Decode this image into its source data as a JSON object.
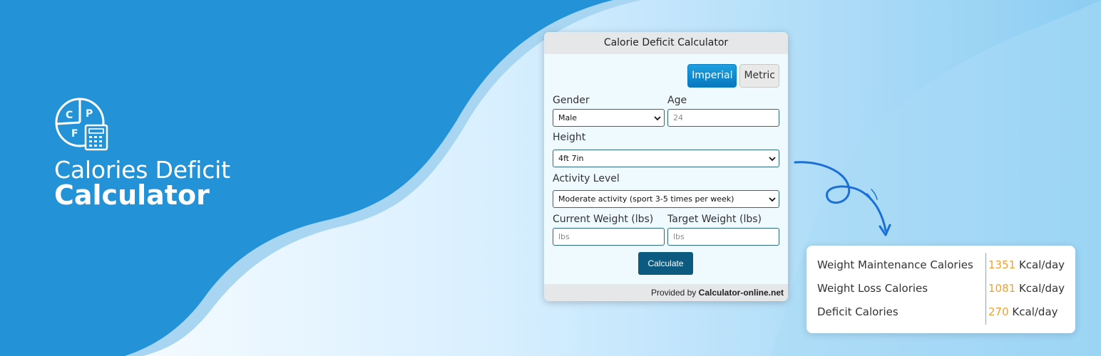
{
  "brand": {
    "logo_letters": [
      "C",
      "P",
      "F"
    ],
    "logo_icon": "calculator-pie-logo-icon",
    "title_line1": "Calories Deficit",
    "title_line2": "Calculator"
  },
  "colors": {
    "brand_blue": "#2492d6",
    "accent_orange": "#f0a12a",
    "button_dark": "#0d5a80"
  },
  "calculator": {
    "title": "Calorie Deficit Calculator",
    "units": [
      {
        "label": "Imperial",
        "active": true
      },
      {
        "label": "Metric",
        "active": false
      }
    ],
    "gender": {
      "label": "Gender",
      "value": "Male"
    },
    "age": {
      "label": "Age",
      "placeholder": "24"
    },
    "height": {
      "label": "Height",
      "value": "4ft 7in"
    },
    "activity": {
      "label": "Activity Level",
      "value": "Moderate activity (sport 3-5 times per week)"
    },
    "current_weight": {
      "label": "Current Weight (lbs)",
      "placeholder": "lbs"
    },
    "target_weight": {
      "label": "Target Weight (lbs)",
      "placeholder": "lbs"
    },
    "calculate_label": "Calculate",
    "footer_prefix": "Provided by",
    "footer_link": "Calculator-online.net"
  },
  "results": [
    {
      "label": "Weight Maintenance Calories",
      "value": "1351",
      "unit": "Kcal/day"
    },
    {
      "label": "Weight Loss Calories",
      "value": "1081",
      "unit": "Kcal/day"
    },
    {
      "label": "Deficit Calories",
      "value": "270",
      "unit": "Kcal/day"
    }
  ]
}
